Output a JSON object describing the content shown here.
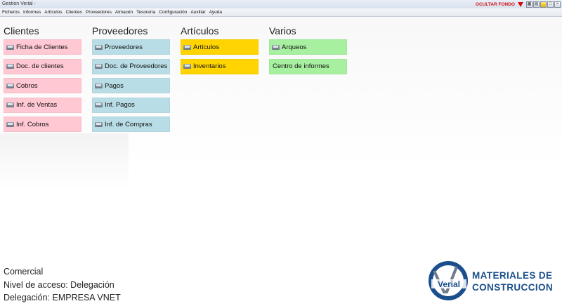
{
  "window": {
    "title": "Gestion Verial -"
  },
  "menu": [
    "Ficheros",
    "Informes",
    "Artículos",
    "Clientes",
    "Proveedores",
    "Almacén",
    "Tesorería",
    "Configuración",
    "Auxiliar",
    "Ayuda"
  ],
  "toolbar": {
    "hide_background": "OCULTAR FONDO"
  },
  "columns": [
    {
      "title": "Clientes",
      "color": "#ffc8d2",
      "items": [
        "Ficha de Clientes",
        "Doc. de clientes",
        "Cobros",
        "Inf. de Ventas",
        "Inf. Cobros"
      ]
    },
    {
      "title": "Proveedores",
      "color": "#b9dde6",
      "items": [
        "Proveedores",
        "Doc. de Proveedores",
        "Pagos",
        "Inf. Pagos",
        "Inf. de Compras"
      ]
    },
    {
      "title": "Artículos",
      "color": "#ffd400",
      "items": [
        "Artículos",
        "Inventarios"
      ]
    },
    {
      "title": "Varios",
      "color": "#a7f0a0",
      "items": [
        "Arqueos",
        "Centro de informes"
      ]
    }
  ],
  "footer": {
    "line1": "Comercial",
    "line2": "Nivel de acceso: Delegación",
    "line3": "Delegación: EMPRESA VNET"
  },
  "logo": {
    "text": "Verial"
  },
  "brand": {
    "line1": "MATERIALES DE",
    "line2": "CONSTRUCCION"
  },
  "colors": {
    "accent": "#1a4e8c",
    "alert": "#d01010"
  }
}
